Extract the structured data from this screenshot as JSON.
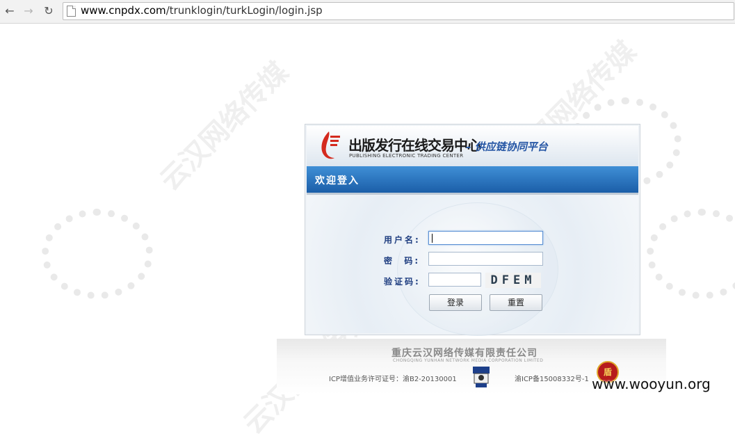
{
  "browser": {
    "url_domain": "www.cnpdx.com",
    "url_path": "/trunklogin/turkLogin/login.jsp",
    "back_icon": "back-arrow-icon",
    "forward_icon": "forward-arrow-icon",
    "reload_icon": "reload-icon"
  },
  "header": {
    "logo_text": "出版发行在线交易中心",
    "logo_subtext": "PUBLISHING ELECTRONIC TRADING CENTER",
    "platform_text": "– 供应链协同平台"
  },
  "welcome": {
    "title": "欢迎登入"
  },
  "form": {
    "username_label": "用户名:",
    "password_label": "密  码:",
    "captcha_label": "验证码:",
    "username_value": "",
    "password_value": "",
    "captcha_value": "",
    "captcha_image_text": "DFEM",
    "login_button": "登录",
    "reset_button": "重置"
  },
  "footer": {
    "company_cn": "重庆云汉网络传媒有限责任公司",
    "company_en": "CHONGQING YUNHAN NETWORK MEDIA CORPORATION LIMITED",
    "icp_license": "ICP增值业务许可证号：渝B2-20130001",
    "icp_record": "渝ICP备15008332号-1"
  },
  "watermark": {
    "text": "www.wooyun.org"
  },
  "colors": {
    "accent_blue": "#1b5ea8",
    "label_blue": "#1f3e80",
    "platform_blue": "#2455a4"
  }
}
